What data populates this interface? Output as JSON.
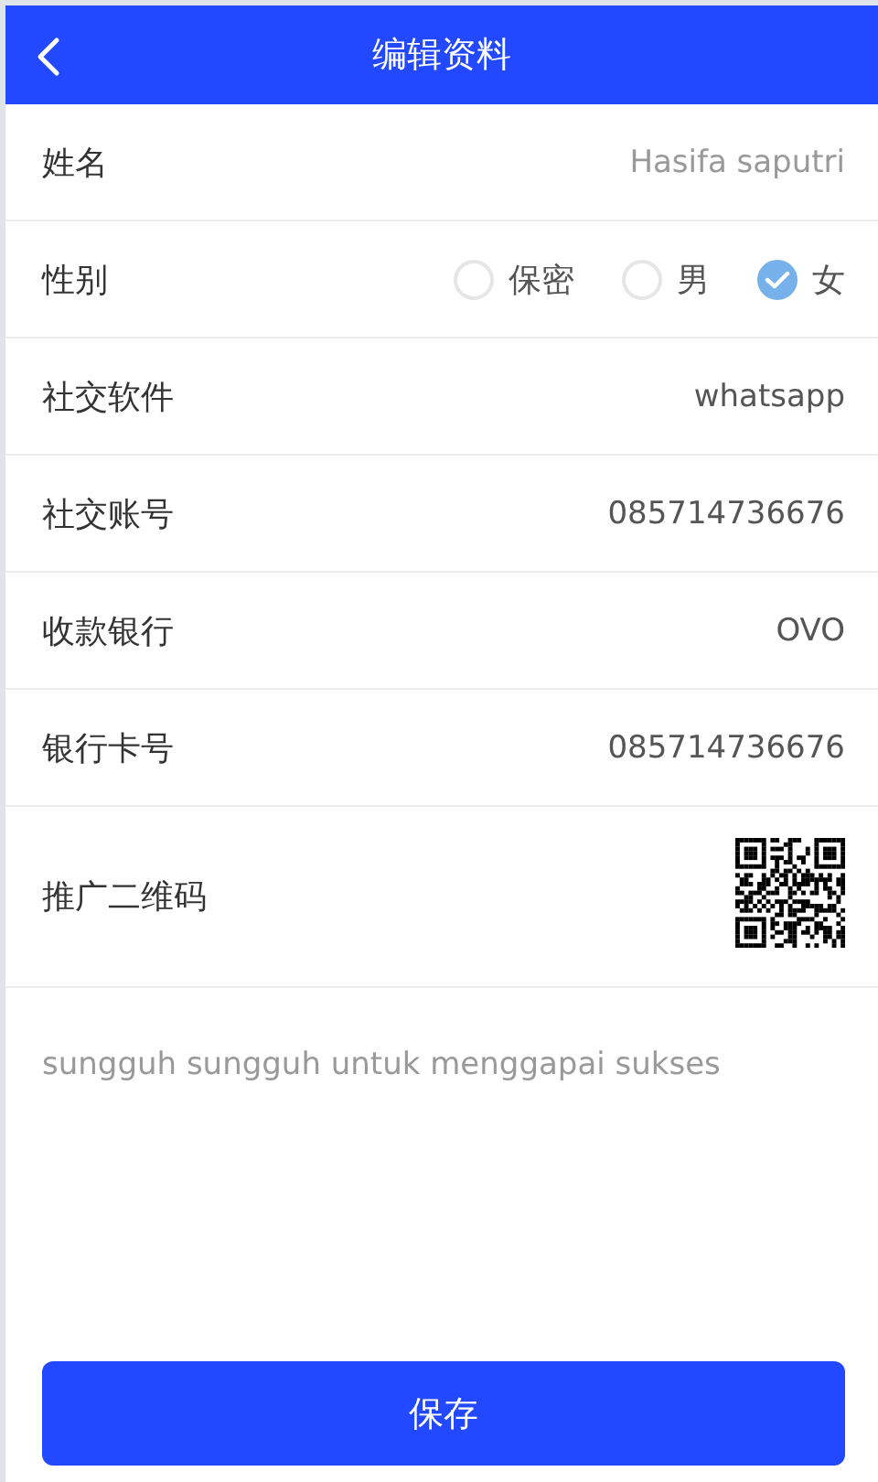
{
  "header": {
    "title": "编辑资料"
  },
  "fields": [
    {
      "kind": "input",
      "label": "姓名",
      "value": "Hasifa saputri"
    },
    {
      "kind": "radio",
      "label": "性别",
      "options": [
        {
          "label": "保密",
          "selected": false
        },
        {
          "label": "男",
          "selected": false
        },
        {
          "label": "女",
          "selected": true
        }
      ]
    },
    {
      "kind": "text",
      "label": "社交软件",
      "value": "whatsapp"
    },
    {
      "kind": "text",
      "label": "社交账号",
      "value": "085714736676"
    },
    {
      "kind": "text",
      "label": "收款银行",
      "value": "OVO"
    },
    {
      "kind": "text",
      "label": "银行卡号",
      "value": "085714736676"
    },
    {
      "kind": "qr",
      "label": "推广二维码"
    }
  ],
  "bio": {
    "value": "sungguh sungguh untuk menggapai sukses"
  },
  "save_button": {
    "label": "保存"
  }
}
